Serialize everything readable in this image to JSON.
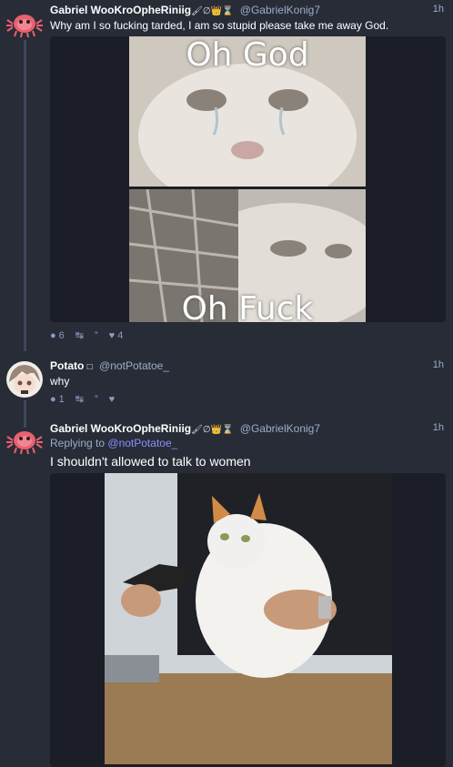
{
  "posts": [
    {
      "display_name": "Gabriel WooKroOpheRiniig",
      "name_emojis": "🖌∅👑⌛",
      "handle": "@GabrielKonig7",
      "time": "1h",
      "text": "Why am I so fucking tarded, I am so stupid please take me away God.",
      "media": {
        "top_caption": "Oh God",
        "bottom_caption": "Oh Fuck"
      },
      "actions": {
        "replies": "6",
        "boosts": "",
        "quote": "",
        "favs": "4"
      }
    },
    {
      "display_name": "Potato",
      "name_emojis": "□",
      "handle": "@notPotatoe_",
      "time": "1h",
      "text": "why",
      "actions": {
        "replies": "1",
        "boosts": "",
        "quote": "",
        "favs": ""
      }
    },
    {
      "display_name": "Gabriel WooKroOpheRiniig",
      "name_emojis": "🖌∅👑⌛",
      "handle": "@GabrielKonig7",
      "time": "1h",
      "reply_prefix": "Replying to",
      "reply_to": "@notPotatoe_",
      "text": "I shouldn't allowed to talk to women"
    }
  ],
  "icons": {
    "reply": "reply-icon",
    "boost": "boost-icon",
    "quote": "quote-icon",
    "favourite": "favourite-icon"
  },
  "colors": {
    "background": "#282c37",
    "accent_link": "#8c8dff",
    "muted": "#9baec8"
  }
}
